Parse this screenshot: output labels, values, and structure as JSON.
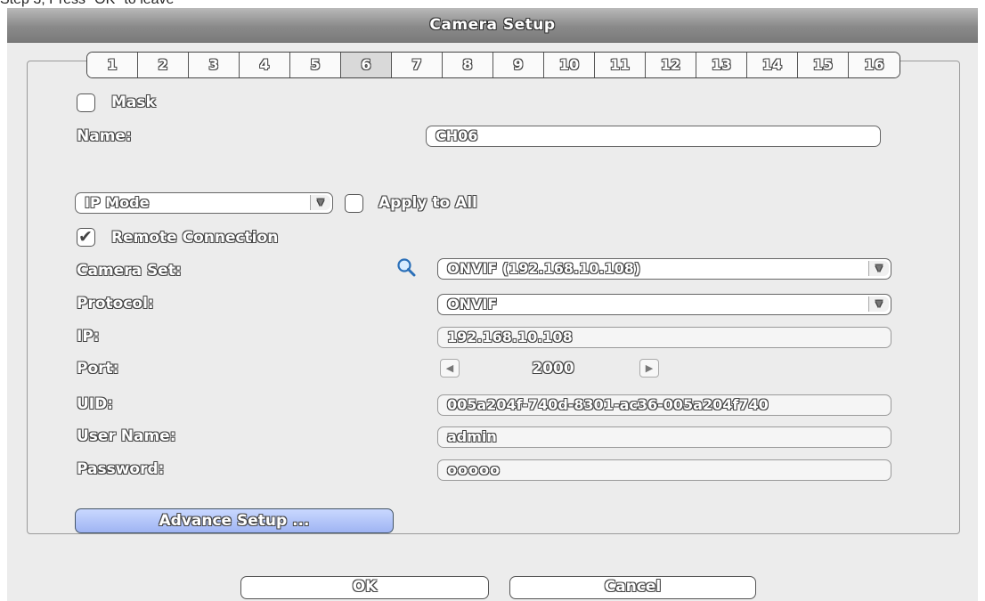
{
  "caption": "Step 3, Press \"OK\" to leave",
  "window": {
    "title": "Camera Setup"
  },
  "tabs": [
    "1",
    "2",
    "3",
    "4",
    "5",
    "6",
    "7",
    "8",
    "9",
    "10",
    "11",
    "12",
    "13",
    "14",
    "15",
    "16"
  ],
  "active_tab": "6",
  "mask": {
    "label": "Mask",
    "checked": false
  },
  "name": {
    "label": "Name:",
    "value": "CH06"
  },
  "mode": {
    "value": "IP Mode"
  },
  "apply_all": {
    "label": "Apply to All",
    "checked": false
  },
  "remote": {
    "label": "Remote Connection",
    "checked": true
  },
  "camera_set": {
    "label": "Camera Set:",
    "value": "ONVIF (192.168.10.108)"
  },
  "protocol": {
    "label": "Protocol:",
    "value": "ONVIF"
  },
  "ip": {
    "label": "IP:",
    "value": "192.168.10.108"
  },
  "port": {
    "label": "Port:",
    "value": "2000"
  },
  "uid": {
    "label": "UID:",
    "value": "005a204f-740d-8301-ac36-005a204f740"
  },
  "user_name": {
    "label": "User Name:",
    "value": "admin"
  },
  "password": {
    "label": "Password:",
    "value": "ooooo"
  },
  "buttons": {
    "advance": "Advance Setup ...",
    "ok": "OK",
    "cancel": "Cancel"
  }
}
